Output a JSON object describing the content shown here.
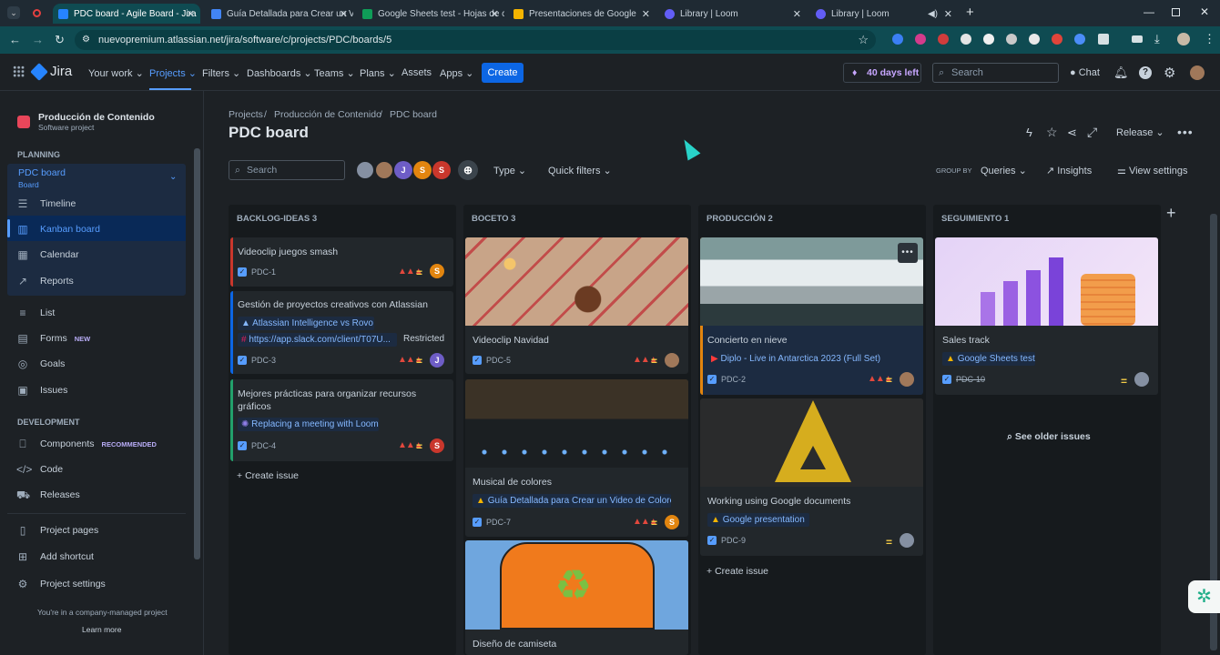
{
  "browser": {
    "tabs": [
      {
        "title": "PDC board - Agile Board - Jira",
        "color": "#2684ff",
        "active": true
      },
      {
        "title": "Guía Detallada para Crear un V",
        "color": "#4285f4"
      },
      {
        "title": "Google Sheets test - Hojas de c",
        "color": "#0f9d58"
      },
      {
        "title": "Presentaciones de Google",
        "color": "#f4b400"
      },
      {
        "title": "Library | Loom",
        "color": "#625df5"
      },
      {
        "title": "Library | Loom",
        "color": "#625df5"
      }
    ],
    "url": "nuevopremium.atlassian.net/jira/software/c/projects/PDC/boards/5"
  },
  "nav": {
    "product": "Jira",
    "items": [
      "Your work",
      "Projects",
      "Filters",
      "Dashboards",
      "Teams",
      "Plans",
      "Assets",
      "Apps"
    ],
    "create": "Create",
    "trial": "40 days left",
    "search_placeholder": "Search",
    "chat": "Chat"
  },
  "sidebar": {
    "project_name": "Producción de Contenido",
    "project_type": "Software project",
    "planning_heading": "PLANNING",
    "board_name": "PDC board",
    "board_sub": "Board",
    "planning_items": [
      "Timeline",
      "Kanban board",
      "Calendar",
      "Reports"
    ],
    "items": [
      "List",
      "Forms",
      "Goals",
      "Issues"
    ],
    "forms_badge": "NEW",
    "dev_heading": "DEVELOPMENT",
    "dev_items": [
      "Components",
      "Code",
      "Releases"
    ],
    "components_badge": "RECOMMENDED",
    "bottom_items": [
      "Project pages",
      "Add shortcut",
      "Project settings"
    ],
    "footer": "You're in a company-managed project",
    "learn_more": "Learn more"
  },
  "board": {
    "breadcrumb": [
      "Projects",
      "Producción de Contenido",
      "PDC board"
    ],
    "title": "PDC board",
    "release": "Release",
    "search_placeholder": "Search",
    "type_filter": "Type",
    "quick_filters": "Quick filters",
    "group_by_label": "GROUP BY",
    "group_by": "Queries",
    "insights": "Insights",
    "view_settings": "View settings",
    "avatars": [
      {
        "letter": "",
        "color": "#8590a2"
      },
      {
        "letter": "",
        "color": "#a0785a"
      },
      {
        "letter": "J",
        "color": "#6e5dc6"
      },
      {
        "letter": "S",
        "color": "#e2850f"
      },
      {
        "letter": "S",
        "color": "#c9372c"
      }
    ],
    "columns": [
      {
        "title": "BACKLOG-IDEAS 3"
      },
      {
        "title": "BOCETO 3"
      },
      {
        "title": "PRODUCCIÓN 2"
      },
      {
        "title": "SEGUIMIENTO 1"
      }
    ],
    "cards": {
      "c1": {
        "title": "Videoclip juegos smash",
        "key": "PDC-1",
        "avatar": "S"
      },
      "c2": {
        "title": "Gestión de proyectos creativos con Atlassian",
        "link1": "Atlassian Intelligence vs Rovo",
        "link2": "https://app.slack.com/client/T07U...",
        "restricted": "Restricted",
        "key": "PDC-3",
        "avatar": "J"
      },
      "c3": {
        "title1": "Mejores prácticas para organizar recursos",
        "title2": "gráficos",
        "link": "Replacing a meeting with Loom",
        "key": "PDC-4",
        "avatar": "S"
      },
      "b1": {
        "title": "Videoclip Navidad",
        "key": "PDC-5"
      },
      "b2": {
        "title": "Musical de colores",
        "link": "Guía Detallada para Crear un Video de Colores",
        "key": "PDC-7",
        "avatar": "S"
      },
      "b3": {
        "title": "Diseño de camiseta"
      },
      "p1": {
        "title": "Concierto en nieve",
        "link": "Diplo - Live in Antarctica 2023 (Full Set)",
        "key": "PDC-2"
      },
      "p2": {
        "title": "Working using Google documents",
        "link": "Google presentation",
        "key": "PDC-9"
      },
      "s1": {
        "title": "Sales track",
        "link": "Google Sheets test",
        "key": "PDC-10"
      }
    },
    "create_issue": "Create issue",
    "see_older": "See older issues"
  }
}
